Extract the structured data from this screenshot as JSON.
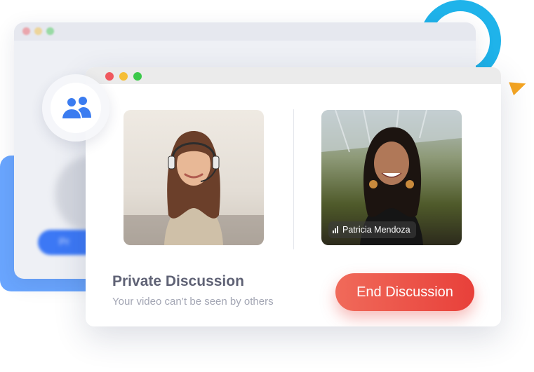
{
  "background_window": {
    "button_label": "Pr"
  },
  "call_window": {
    "participants": [
      {
        "name": "",
        "role": "self"
      },
      {
        "name": "Patricia Mendoza",
        "role": "remote",
        "signal_icon": "signal-bars-icon"
      }
    ],
    "title": "Private Discussion",
    "subtitle": "Your video can’t be seen by others",
    "end_button_label": "End Discussion"
  },
  "badge": {
    "icon": "people-group-icon"
  },
  "colors": {
    "accent_blue": "#3c78f5",
    "end_button": "#e8403a",
    "ring": "#1fb3ea",
    "triangle": "#f5a522",
    "title_text": "#5f6275",
    "subtitle_text": "#a3a6b4"
  }
}
